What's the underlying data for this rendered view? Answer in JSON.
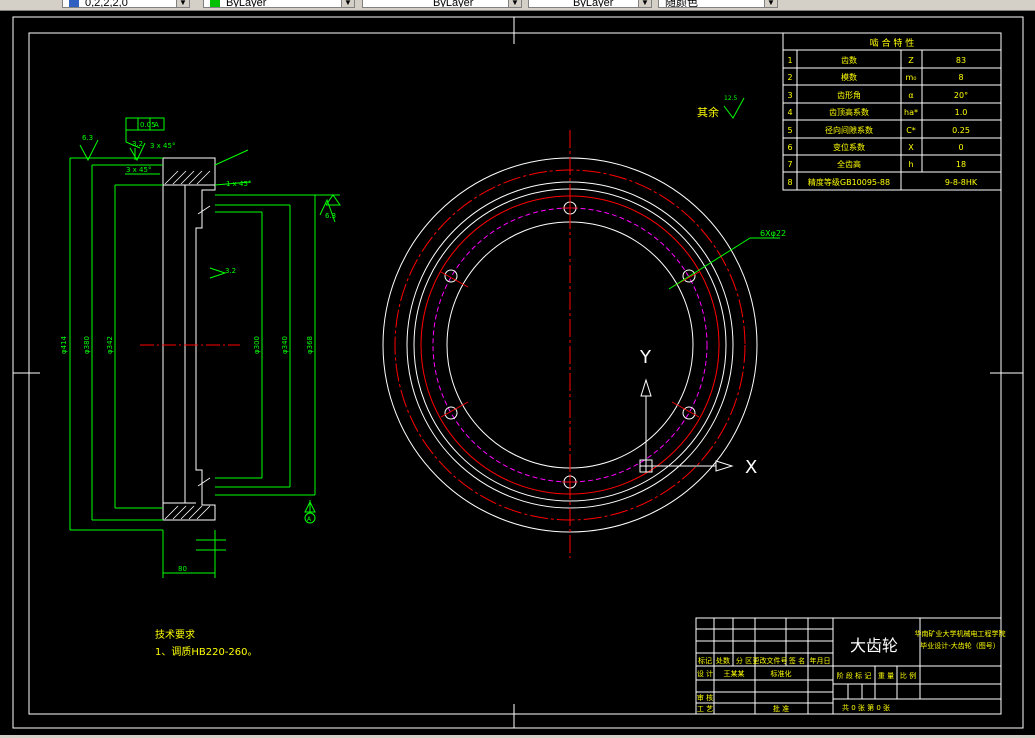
{
  "toolbar": {
    "layer_value": "0,2,2,2,0",
    "color_value": "ByLayer",
    "linetype_value": "ByLayer",
    "lineweight_value": "ByLayer",
    "plotstyle_value": "随颜色"
  },
  "drawing": {
    "surface_roughness_note": "其余",
    "surface_roughness_value": "12.5",
    "hole_callout": "6Xφ22",
    "ucs_x_label": "X",
    "ucs_y_label": "Y",
    "tech_requirements_title": "技术要求",
    "tech_requirements_item": "1、调质HB220-260。",
    "left_dims": {
      "flatness": "0.05",
      "datum_a": "A",
      "chamfer_top": "3 x 45°",
      "chamfer_inner": "3 x 45°",
      "chamfer_small": "1 x 45°",
      "roughness_a": "6.3",
      "roughness_b": "3.2",
      "roughness_c": "3.2",
      "roughness_d": "6.3",
      "dia_outer": "φ414",
      "dia_mid": "φ380",
      "dia_inner": "φ342",
      "dia_right_a": "φ300",
      "dia_right_b": "φ340",
      "dia_right_c": "φ368",
      "width": "80",
      "datum_label": "A"
    }
  },
  "mesh_table": {
    "title": "啮 合 特 性",
    "rows": [
      {
        "no": "1",
        "name": "齿数",
        "sym": "Z",
        "val": "83"
      },
      {
        "no": "2",
        "name": "模数",
        "sym": "m₀",
        "val": "8"
      },
      {
        "no": "3",
        "name": "齿形角",
        "sym": "α",
        "val": "20°"
      },
      {
        "no": "4",
        "name": "齿顶高系数",
        "sym": "ha*",
        "val": "1.0"
      },
      {
        "no": "5",
        "name": "径向间隙系数",
        "sym": "C*",
        "val": "0.25"
      },
      {
        "no": "6",
        "name": "变位系数",
        "sym": "X",
        "val": "0"
      },
      {
        "no": "7",
        "name": "全齿高",
        "sym": "h",
        "val": "18"
      },
      {
        "no": "8",
        "name": "精度等级GB10095-88",
        "sym": "",
        "val": "9-8-8HK"
      }
    ]
  },
  "title_block": {
    "part_name": "大齿轮",
    "org_line1": "华南矿业大学机械电工程学院",
    "org_line2": "毕业设计-大齿轮（图号）",
    "hdr_mark": "标记",
    "hdr_count": "处数",
    "hdr_zone": "分 区",
    "hdr_changeno": "更改文件号",
    "hdr_sign": "签 名",
    "hdr_date": "年月日",
    "design": "设 计",
    "designer": "王某某",
    "standard": "标准化",
    "review": "审 核",
    "process": "工 艺",
    "approve": "批 准",
    "stage_mark": "阶 段 标 记",
    "weight": "重 量",
    "scale": "比 例",
    "sheets": "共 0 张  第 0 张"
  },
  "colors": {
    "frame": "#ffffff",
    "dimension": "#00ff00",
    "centerline": "#ff0000",
    "text_yellow": "#ffff00",
    "pitch_circle": "#ff00ff"
  }
}
